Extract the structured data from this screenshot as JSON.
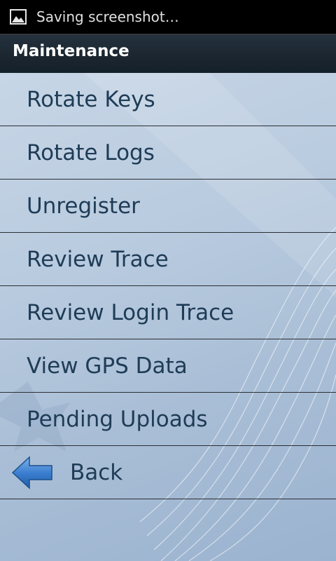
{
  "status_bar": {
    "icon": "image-icon",
    "text": "Saving screenshot…"
  },
  "title_bar": {
    "title": "Maintenance"
  },
  "menu": {
    "items": [
      {
        "label": "Rotate Keys"
      },
      {
        "label": "Rotate Logs"
      },
      {
        "label": "Unregister"
      },
      {
        "label": "Review Trace"
      },
      {
        "label": "Review Login Trace"
      },
      {
        "label": "View GPS Data"
      },
      {
        "label": "Pending Uploads"
      }
    ],
    "back": {
      "label": "Back",
      "icon": "back-arrow-icon"
    }
  },
  "colors": {
    "label_text": "#1f3c56",
    "title_bar": "#1b2630",
    "divider": "#2b2f33",
    "back_arrow": "#3c7fd0"
  }
}
